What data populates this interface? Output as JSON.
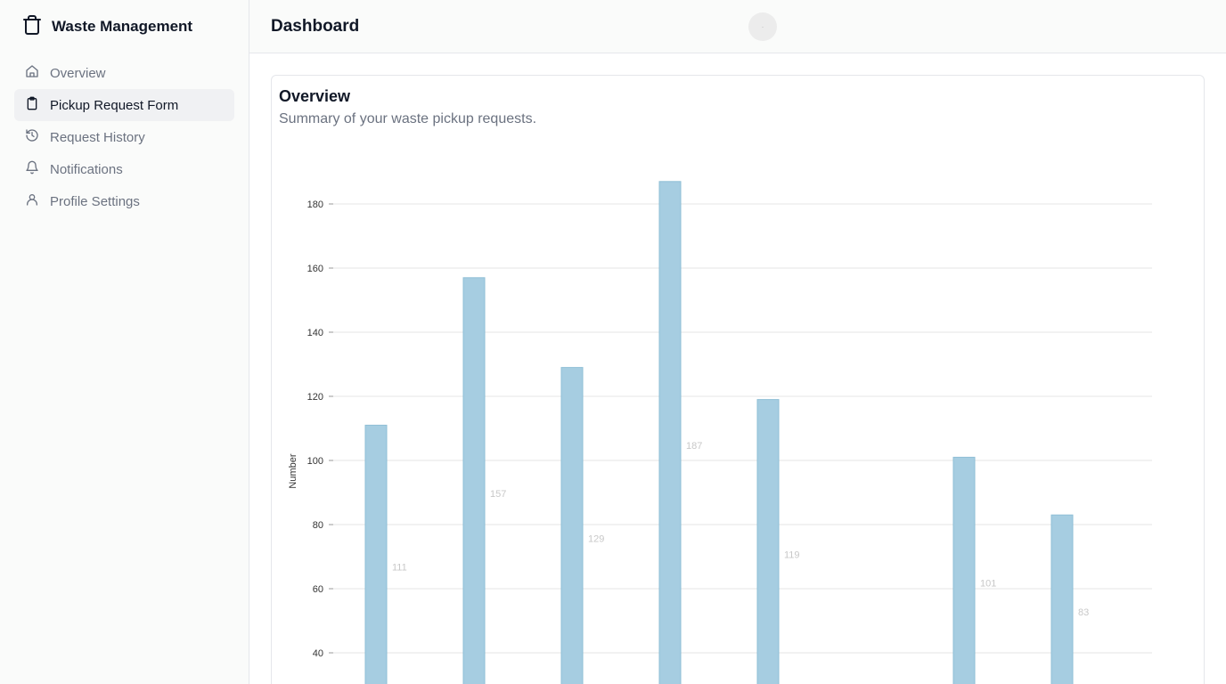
{
  "sidebar": {
    "brand": {
      "title": "Waste Management",
      "icon": "trash-icon"
    },
    "items": [
      {
        "label": "Overview",
        "icon": "home-icon",
        "active": false
      },
      {
        "label": "Pickup Request Form",
        "icon": "clipboard-icon",
        "active": true
      },
      {
        "label": "Request History",
        "icon": "history-icon",
        "active": false
      },
      {
        "label": "Notifications",
        "icon": "bell-icon",
        "active": false
      },
      {
        "label": "Profile Settings",
        "icon": "user-icon",
        "active": false
      }
    ]
  },
  "header": {
    "title": "Dashboard",
    "avatar": "avatar-icon"
  },
  "card": {
    "title": "Overview",
    "description": "Summary of your waste pickup requests."
  },
  "colors": {
    "bar": "#a6cde1",
    "bar_stroke": "#8fbfd6",
    "grid": "#e5e5e5",
    "data_label": "#c8c8c8"
  },
  "chart_data": {
    "type": "bar",
    "ylabel": "Number",
    "xlabel": "",
    "ylim": [
      30,
      190
    ],
    "yticks": [
      40,
      60,
      80,
      100,
      120,
      140,
      160,
      180
    ],
    "grid": true,
    "values": [
      111,
      157,
      129,
      187,
      119,
      null,
      101,
      83
    ],
    "data_labels": [
      "111",
      "157",
      "129",
      "187",
      "119",
      "",
      "101",
      "83"
    ]
  }
}
